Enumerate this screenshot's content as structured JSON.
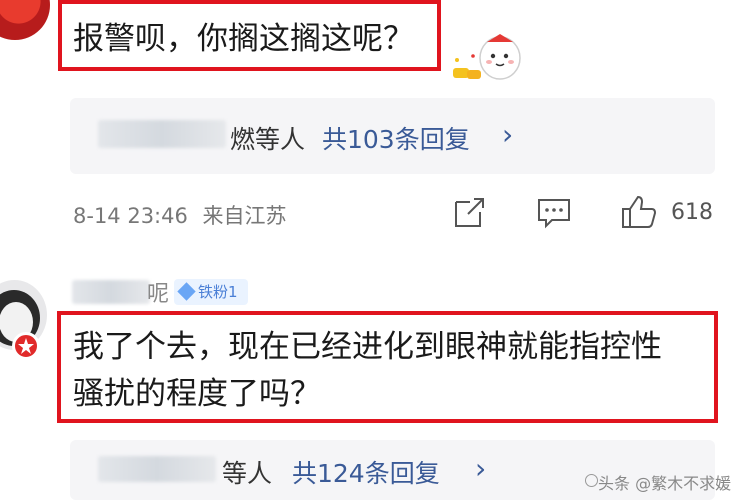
{
  "comment1": {
    "text": "报警呗，你搁这搁这呢？"
  },
  "reply_summary1": {
    "name_suffix": "燃等人",
    "count": "共103条回复",
    "chevron": "›"
  },
  "meta1": {
    "date": "8-14 23:46",
    "location": "来自江苏",
    "likes": "618",
    "icons": [
      "share-icon",
      "comment-icon",
      "like-icon"
    ]
  },
  "user2": {
    "name_suffix": "呢",
    "badge": "铁粉1"
  },
  "comment2": {
    "line1": "我了个去，现在已经进化到眼神就能指控性",
    "line2": "骚扰的程度了吗？"
  },
  "reply_summary2": {
    "name_suffix": "等人",
    "count": "共124条回复",
    "chevron": "›"
  },
  "watermark": {
    "text": "头条 @繁木不求媛"
  },
  "colors": {
    "highlight": "#e0141e",
    "reply_link": "#3a5a97",
    "fan_badge": "#4a7fd6"
  }
}
